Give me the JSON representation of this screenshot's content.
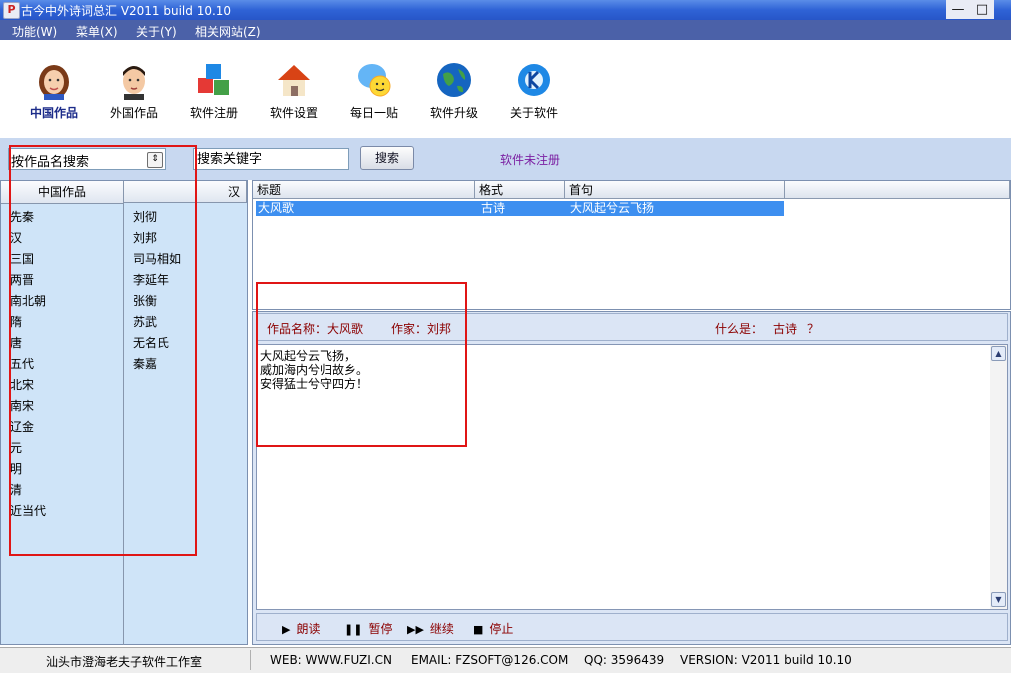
{
  "window": {
    "title": "古今中外诗词总汇 V2011 build 10.10",
    "minimize": "—",
    "maximize": "□"
  },
  "menu": [
    "功能(W)",
    "菜单(X)",
    "关于(Y)",
    "相关网站(Z)"
  ],
  "toolbar": [
    {
      "label": "中国作品",
      "icon": "woman-face-icon",
      "active": true
    },
    {
      "label": "外国作品",
      "icon": "man-face-icon"
    },
    {
      "label": "软件注册",
      "icon": "cubes-icon"
    },
    {
      "label": "软件设置",
      "icon": "house-icon"
    },
    {
      "label": "每日一贴",
      "icon": "smiley-bubble-icon"
    },
    {
      "label": "软件升级",
      "icon": "globe-icon"
    },
    {
      "label": "关于软件",
      "icon": "kde-gear-icon"
    }
  ],
  "search": {
    "mode": "按作品名搜索",
    "placeholder": "搜索关键字",
    "button": "搜索",
    "status": "软件未注册"
  },
  "left": {
    "col1_header": "中国作品",
    "col2_header": "汉",
    "dynasties": [
      "先秦",
      "汉",
      "三国",
      "两晋",
      "南北朝",
      "隋",
      "唐",
      "五代",
      "北宋",
      "南宋",
      "辽金",
      "元",
      "明",
      "清",
      "近当代"
    ],
    "poets": [
      "刘彻",
      "刘邦",
      "司马相如",
      "李延年",
      "张衡",
      "苏武",
      "无名氏",
      "秦嘉"
    ]
  },
  "table": {
    "headers": [
      "标题",
      "格式",
      "首句"
    ],
    "rows": [
      {
        "title": "大风歌",
        "format": "古诗",
        "first_line": "大风起兮云飞扬"
      }
    ]
  },
  "detail": {
    "work_label": "作品名称：大风歌",
    "author_label": "作家：刘邦",
    "whatis_label": "什么是：",
    "whatis_value": "古诗",
    "whatis_q": "？",
    "poem": [
      "大风起兮云飞扬，",
      "威加海内兮归故乡。",
      "安得猛士兮守四方！"
    ]
  },
  "controls": {
    "play": "朗读",
    "pause": "暂停",
    "resume": "继续",
    "stop": "停止"
  },
  "status": {
    "studio": "汕头市澄海老夫子软件工作室",
    "web": "WEB: WWW.FUZI.CN",
    "email": "EMAIL: FZSOFT@126.COM",
    "qq": "QQ: 3596439",
    "version": "VERSION: V2011 build 10.10"
  },
  "colors": {
    "accent": "#1c2c8a",
    "selection": "#3d8ff0",
    "annotation": "#e01515",
    "panel": "#cfe4f8"
  }
}
